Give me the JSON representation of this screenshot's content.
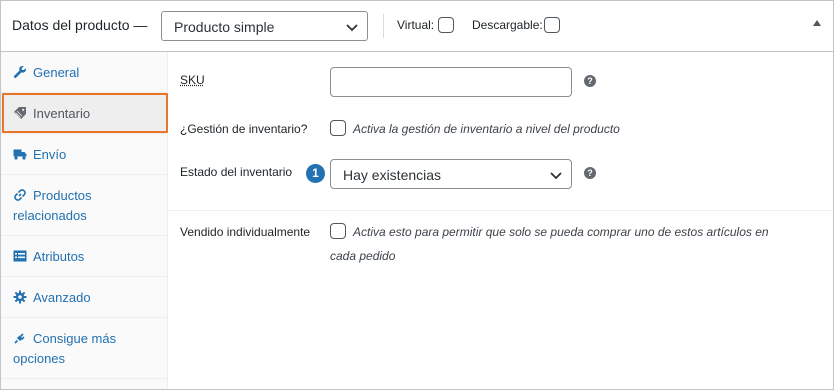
{
  "header": {
    "title": "Datos del producto —",
    "product_type": "Producto simple",
    "virtual_label": "Virtual:",
    "downloadable_label": "Descargable:"
  },
  "sidebar": {
    "items": [
      {
        "label": "General",
        "icon": "wrench-icon"
      },
      {
        "label": "Inventario",
        "icon": "tag-icon",
        "active": true
      },
      {
        "label": "Envío",
        "icon": "truck-icon"
      },
      {
        "label_line1": "Productos",
        "label_line2": "relacionados",
        "icon": "link-icon"
      },
      {
        "label": "Atributos",
        "icon": "list-icon"
      },
      {
        "label": "Avanzado",
        "icon": "gear-icon"
      },
      {
        "label_line1": "Consigue más",
        "label_line2": "opciones",
        "icon": "plugin-icon"
      }
    ]
  },
  "main": {
    "sku_label": "SKU",
    "sku_value": "",
    "manage_stock_label": "¿Gestión de inventario?",
    "manage_stock_desc": "Activa la gestión de inventario a nivel del producto",
    "stock_status_label": "Estado del inventario",
    "stock_status_value": "Hay existencias",
    "badge_number": "1",
    "sold_individually_label": "Vendido individualmente",
    "sold_individually_desc_line1": "Activa esto para permitir que solo se pueda comprar uno de estos artículos en",
    "sold_individually_desc_line2": "cada pedido",
    "help_glyph": "?"
  },
  "colors": {
    "link": "#2271b1",
    "highlight_outline": "#e8752a",
    "badge": "#2271b1"
  }
}
